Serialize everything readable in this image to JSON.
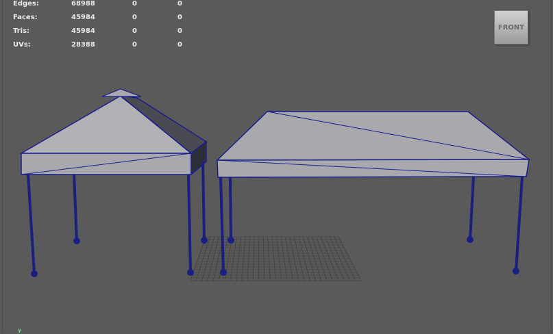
{
  "hud": {
    "rows": [
      {
        "label": "Edges:",
        "v1": "68988",
        "v2": "0",
        "v3": "0"
      },
      {
        "label": "Faces:",
        "v1": "45984",
        "v2": "0",
        "v3": "0"
      },
      {
        "label": "Tris:",
        "v1": "45984",
        "v2": "0",
        "v3": "0"
      },
      {
        "label": "UVs:",
        "v1": "28388",
        "v2": "0",
        "v3": "0"
      }
    ]
  },
  "viewcube": {
    "label": "FRONT"
  },
  "axis": {
    "y_label": "y"
  },
  "colors": {
    "background": "#5a5a5a",
    "canopy": "#a9a9ad",
    "wireframe": "#1a1f8a",
    "legs": "#1c1f82",
    "grid": "#3a3a3a"
  }
}
